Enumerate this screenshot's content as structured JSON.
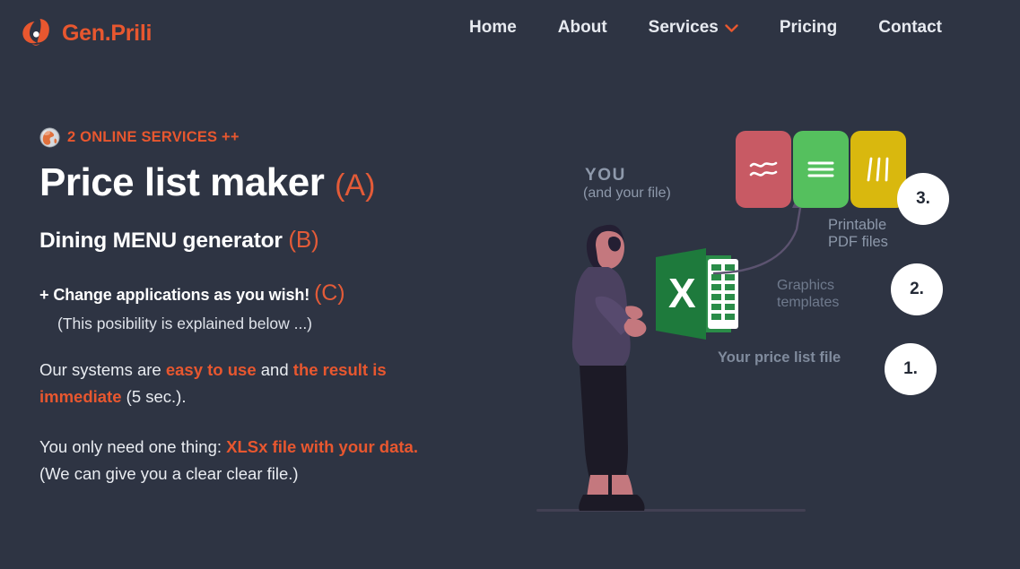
{
  "brand": {
    "name": "Gen.Prili",
    "logo_icon": "genprili-leaf-logo",
    "accent": "#e8572f"
  },
  "nav": {
    "items": [
      {
        "label": "Home",
        "icon": null
      },
      {
        "label": "About",
        "icon": null
      },
      {
        "label": "Services",
        "icon": "chevron-down-icon"
      },
      {
        "label": "Pricing",
        "icon": null
      },
      {
        "label": "Contact",
        "icon": null
      }
    ]
  },
  "hero": {
    "badge": {
      "icon": "globe-icon",
      "text": "2 ONLINE SERVICES ++"
    },
    "title": {
      "main": "Price list maker",
      "tag": "(A)"
    },
    "subtitle": {
      "main": "Dining MENU generator",
      "tag": "(B)"
    },
    "feature": {
      "main": "+ Change applications as you wish!",
      "tag": "(C)"
    },
    "feature_note": "(This posibility is explained below ...)",
    "paragraph1": {
      "seg1": "Our systems are ",
      "hi1": "easy to use",
      "seg2": " and ",
      "hi2": "the result is immediate",
      "seg3": " (5 sec.)."
    },
    "paragraph2": {
      "seg1": "You only need one thing: ",
      "hi1": "XLSx file with your data.",
      "seg2": " (We can give you a clear clear file.)"
    }
  },
  "illustration": {
    "you_label": "YOU",
    "you_sublabel": "(and your file)",
    "pdf_label": "Printable\nPDF files",
    "graphics_label": "Graphics\ntemplates",
    "price_label": "Your price list file",
    "person_icon": "person-holding-file-illustration",
    "excel_icon": "excel-file-icon",
    "arrow_icon": "curved-up-arrow-icon",
    "steps": [
      {
        "number": "1."
      },
      {
        "number": "2."
      },
      {
        "number": "3."
      }
    ],
    "cards": [
      {
        "icon": "wave-equals-icon",
        "color": "#c85a64",
        "glyph": "approximately-equal"
      },
      {
        "icon": "horizontal-lines-icon",
        "color": "#55c05e",
        "glyph": "triple-horizontal-line"
      },
      {
        "icon": "vertical-bars-icon",
        "color": "#d9b80e",
        "glyph": "triple-vertical-line"
      }
    ]
  },
  "colors": {
    "background": "#2e3443",
    "accent_orange": "#e8572f",
    "tag_orange": "#e35b38",
    "text_white": "#ffffff",
    "muted": "#8e99ab",
    "excel_green": "#1e7a3c"
  }
}
